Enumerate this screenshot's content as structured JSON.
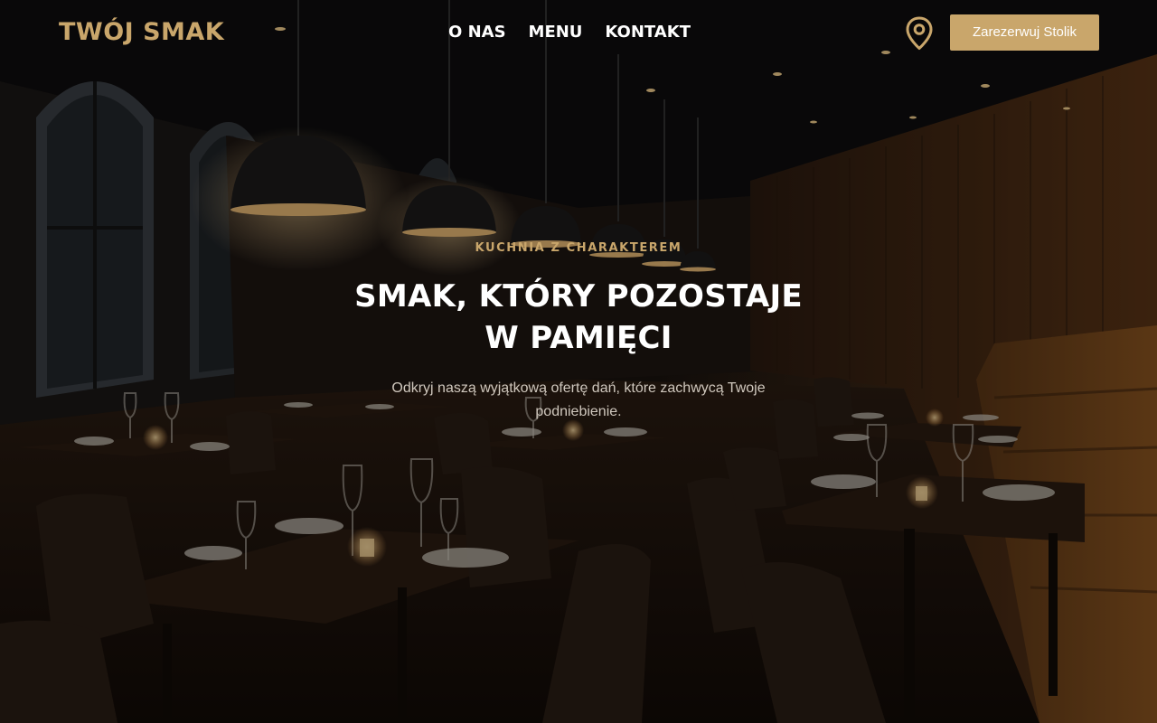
{
  "brand": {
    "name": "TWÓJ SMAK"
  },
  "nav": {
    "items": [
      {
        "label": "O NAS"
      },
      {
        "label": "MENU"
      },
      {
        "label": "KONTAKT"
      }
    ]
  },
  "header": {
    "location_icon": "map-pin-icon",
    "reserve_label": "Zarezerwuj Stolik"
  },
  "hero": {
    "eyebrow": "KUCHNIA Z CHARAKTEREM",
    "title": "SMAK, KTÓRY POZOSTAJE W PAMIĘCI",
    "subtitle": "Odkryj naszą wyjątkową ofertę dań, które zachwycą Twoje podniebienie.",
    "background_image": "dark restaurant interior with pendant lamps and set tables"
  },
  "colors": {
    "accent": "#c9a66b",
    "text": "#ffffff",
    "muted": "#cfc7bd"
  }
}
